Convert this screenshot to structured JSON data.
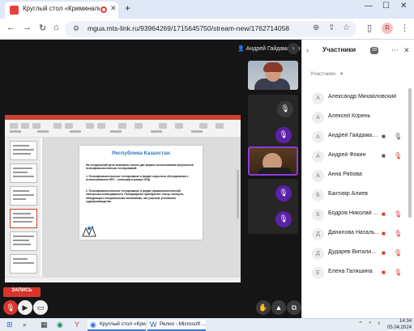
{
  "browser": {
    "tab_title": "Круглый стол «Криминальн»",
    "url": "mgua.mts-link.ru/93964269/1715645750/stream-new/1762714058",
    "new_tab": "+"
  },
  "meeting": {
    "host_name": "Андрей Гайдамашко",
    "brand_label": "ЗАПИСЬ"
  },
  "slide": {
    "title": "Республика Казахстан",
    "intro": "На сегодняшний день возможны только две формы использования результатов психофизиологических тестирований:",
    "point1": "1. Психофизиологическое тестирование в форме опросного обследования с использованием ИПС – полиграф в рамках ОРД.",
    "point2": "2. Психофизиологическое тестирование в форме криминалистической экспертизы-полиграфолога. Полиграфолог приобретает статус эксперта, обладающего специальными познаниями, как участник уголовного судопроизводства."
  },
  "panel": {
    "title": "Участники",
    "count": "28",
    "sort_label": "Участники",
    "participants": [
      {
        "initial": "А",
        "name": "Александр Михайловский"
      },
      {
        "initial": "А",
        "name": "Алексей Корень"
      },
      {
        "initial": "А",
        "name": "Андрей Гайдамаш..."
      },
      {
        "initial": "А",
        "name": "Андрей Фокин"
      },
      {
        "initial": "А",
        "name": "Анна Рябова"
      },
      {
        "initial": "Б",
        "name": "Бахтияр Алиев"
      },
      {
        "initial": "Б",
        "name": "Бодров Николай ..."
      },
      {
        "initial": "Д",
        "name": "Данилова Наталь..."
      },
      {
        "initial": "Д",
        "name": "Дударев Виталий ..."
      },
      {
        "initial": "Е",
        "name": "Елена Галяшина"
      }
    ]
  },
  "taskbar": {
    "app1": "Круглый стол «Кри...",
    "app2": "Релиз - Microsoft ...",
    "time": "14:34",
    "date": "05.04.2024"
  }
}
